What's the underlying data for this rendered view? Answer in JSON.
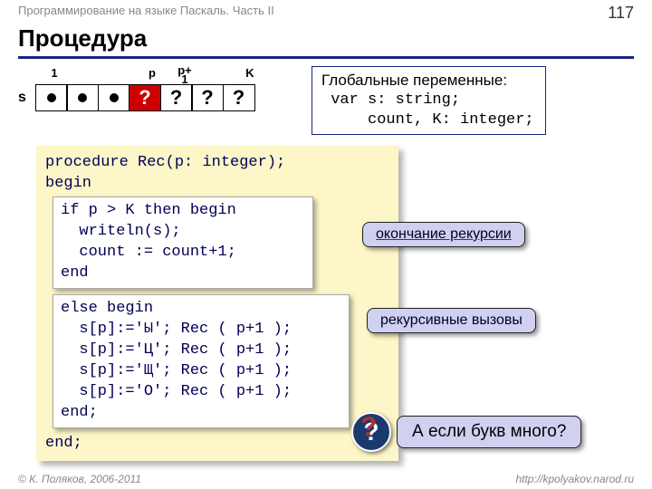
{
  "header": {
    "subtitle": "Программирование на языке Паскаль. Часть II",
    "page": "117"
  },
  "title": "Процедура",
  "array": {
    "label_s": "s",
    "label_1": "1",
    "label_p": "p",
    "label_p1a": "p+",
    "label_p1b": "1",
    "label_k": "K",
    "red_q": "?",
    "q1": "?",
    "q2": "?",
    "q3": "?"
  },
  "globals": {
    "line1": "Глобальные переменные:",
    "line2": " var s: string;",
    "line3": "     count, K: integer;"
  },
  "code": {
    "l1": "procedure Rec(p: integer);",
    "l2": "begin",
    "box1_l1": "if p > K then begin",
    "box1_l2": "  writeln(s);",
    "box1_l3": "  count := count+1;",
    "box1_l4": "end",
    "box2_l1": "else begin",
    "box2_l2": "  s[p]:='Ы'; Rec ( p+1 );",
    "box2_l3": "  s[p]:='Ц'; Rec ( p+1 );",
    "box2_l4": "  s[p]:='Щ'; Rec ( p+1 );",
    "box2_l5": "  s[p]:='О'; Rec ( p+1 );",
    "box2_l6": "end;",
    "l_end": "end;"
  },
  "callouts": {
    "c1": "окончание рекурсии",
    "c2": "рекурсивные вызовы"
  },
  "question": "А если букв много?",
  "footer": {
    "left": "© К. Поляков, 2006-2011",
    "right": "http://kpolyakov.narod.ru"
  }
}
